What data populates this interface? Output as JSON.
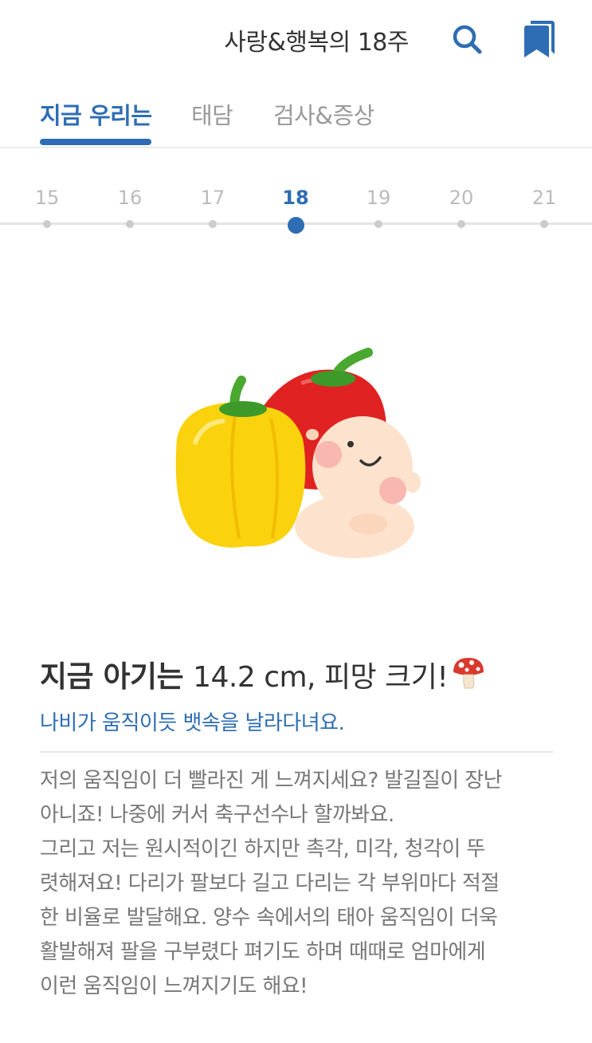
{
  "header": {
    "title": "사랑&행복의 18주",
    "search_icon": "search-icon",
    "bookmark_icon": "bookmark-icon"
  },
  "tabs": [
    {
      "label": "지금 우리는",
      "active": true
    },
    {
      "label": "태담",
      "active": false
    },
    {
      "label": "검사&증상",
      "active": false
    }
  ],
  "weeks": {
    "items": [
      "15",
      "16",
      "17",
      "18",
      "19",
      "20",
      "21"
    ],
    "selected": "18"
  },
  "illustration": {
    "description_icon": "baby-with-bell-peppers"
  },
  "info": {
    "size_prefix": "지금 아기는",
    "size_text": "14.2 cm, 피망 크기!",
    "size_icon": "mushroom-icon",
    "subtitle": "나비가 움직이듯 뱃속을 날라다녀요.",
    "description_lines": [
      "저의 움직임이 더 빨라진 게 느껴지세요? 발길질이 장난",
      "아니죠! 나중에 커서 축구선수나 할까봐요.",
      "그리고 저는 원시적이긴 하지만 촉각, 미각, 청각이 뚜",
      "렷해져요! 다리가 팔보다 길고 다리는 각 부위마다 적절",
      "한 비율로 발달해요. 양수 속에서의 태아 움직임이 더욱",
      "활발해져 팔을 구부렸다 펴기도 하며 때때로 엄마에게",
      "이런 움직임이 느껴지기도 해요!"
    ]
  },
  "colors": {
    "accent": "#2e6db4",
    "text": "#333333",
    "muted": "#999999",
    "body": "#777777"
  }
}
